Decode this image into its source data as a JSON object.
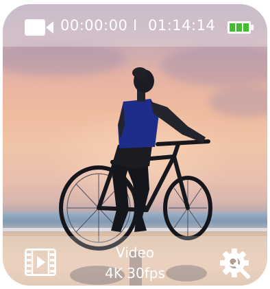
{
  "status_bar": {
    "record_time": "00:00:00",
    "separator": "I",
    "remaining_time": "01:14:14",
    "camera_icon": "video-camera-icon",
    "battery_icon": "battery-full-icon",
    "battery_color": "#3fbf2e"
  },
  "bottom_bar": {
    "mode": "Video",
    "resolution": "4K 30fps",
    "left_icon": "film-play-icon",
    "right_icon": "settings-gear-icon"
  }
}
